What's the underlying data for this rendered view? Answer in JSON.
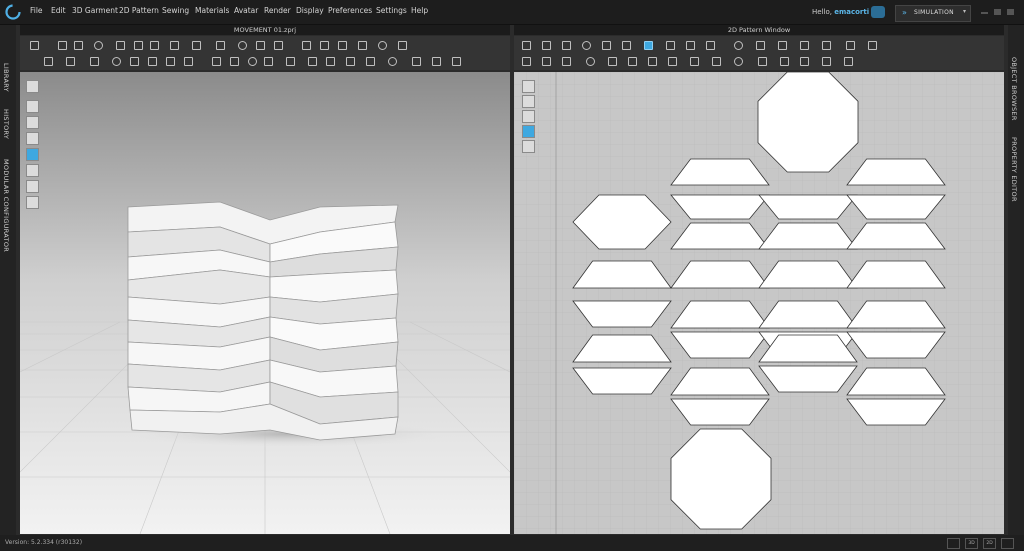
{
  "app": {
    "menus": [
      "File",
      "Edit",
      "3D Garment",
      "2D Pattern",
      "Sewing",
      "Materials",
      "Avatar",
      "Render",
      "Display",
      "Preferences",
      "Settings",
      "Help"
    ],
    "greeting": "Hello,",
    "username": "emacorti",
    "mode_label": "SIMULATION",
    "accent_color": "#3ea8e0"
  },
  "sidebar_left": {
    "tabs": [
      "LIBRARY",
      "HISTORY",
      "MODULAR CONFIGURATOR"
    ]
  },
  "sidebar_right": {
    "tabs": [
      "OBJECT BROWSER",
      "PROPERTY EDITOR"
    ]
  },
  "pane3d": {
    "title": "MOVEMENT 01.zprj"
  },
  "pane2d": {
    "title": "2D Pattern Window"
  },
  "statusbar": {
    "version": "Version: 5.2.334 (r30132)",
    "view_buttons": [
      "",
      "3D",
      "2D",
      ""
    ]
  }
}
